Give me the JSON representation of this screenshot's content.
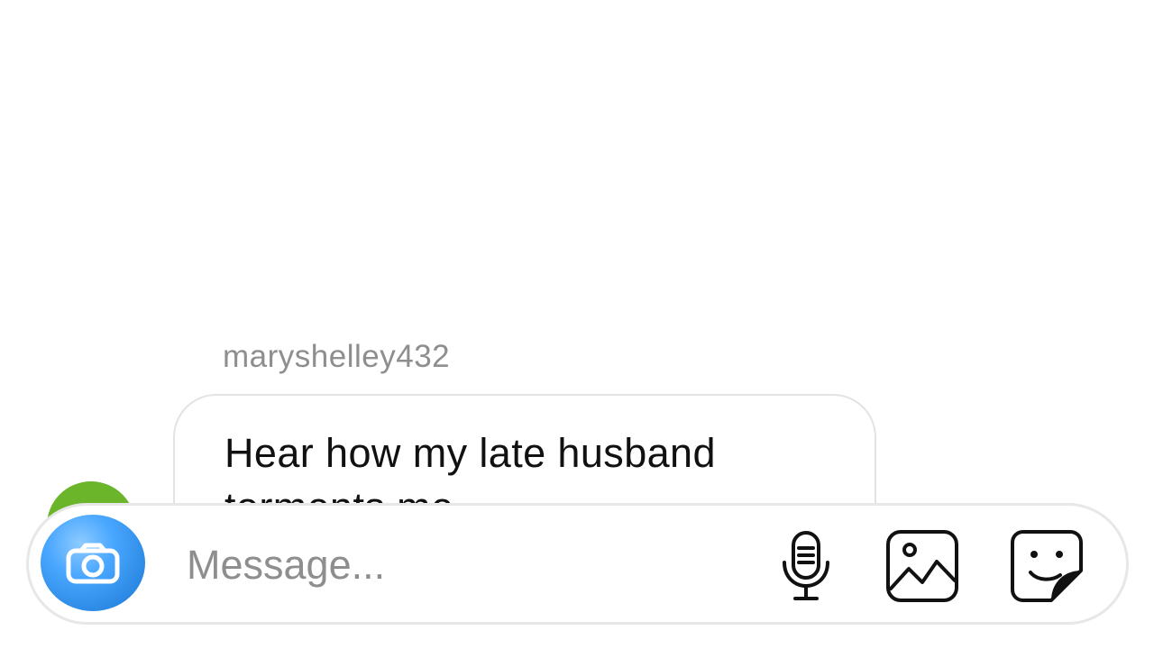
{
  "conversation": {
    "sender": "maryshelley432",
    "message": "Hear how my late husband torments me"
  },
  "composer": {
    "placeholder": "Message...",
    "camera_icon": "camera-icon",
    "microphone_icon": "microphone-icon",
    "gallery_icon": "image-gallery-icon",
    "sticker_icon": "sticker-icon"
  },
  "colors": {
    "camera_button": "#3897f0",
    "text": "#111111",
    "muted_text": "#8e8e8e",
    "border": "#e3e3e3"
  }
}
